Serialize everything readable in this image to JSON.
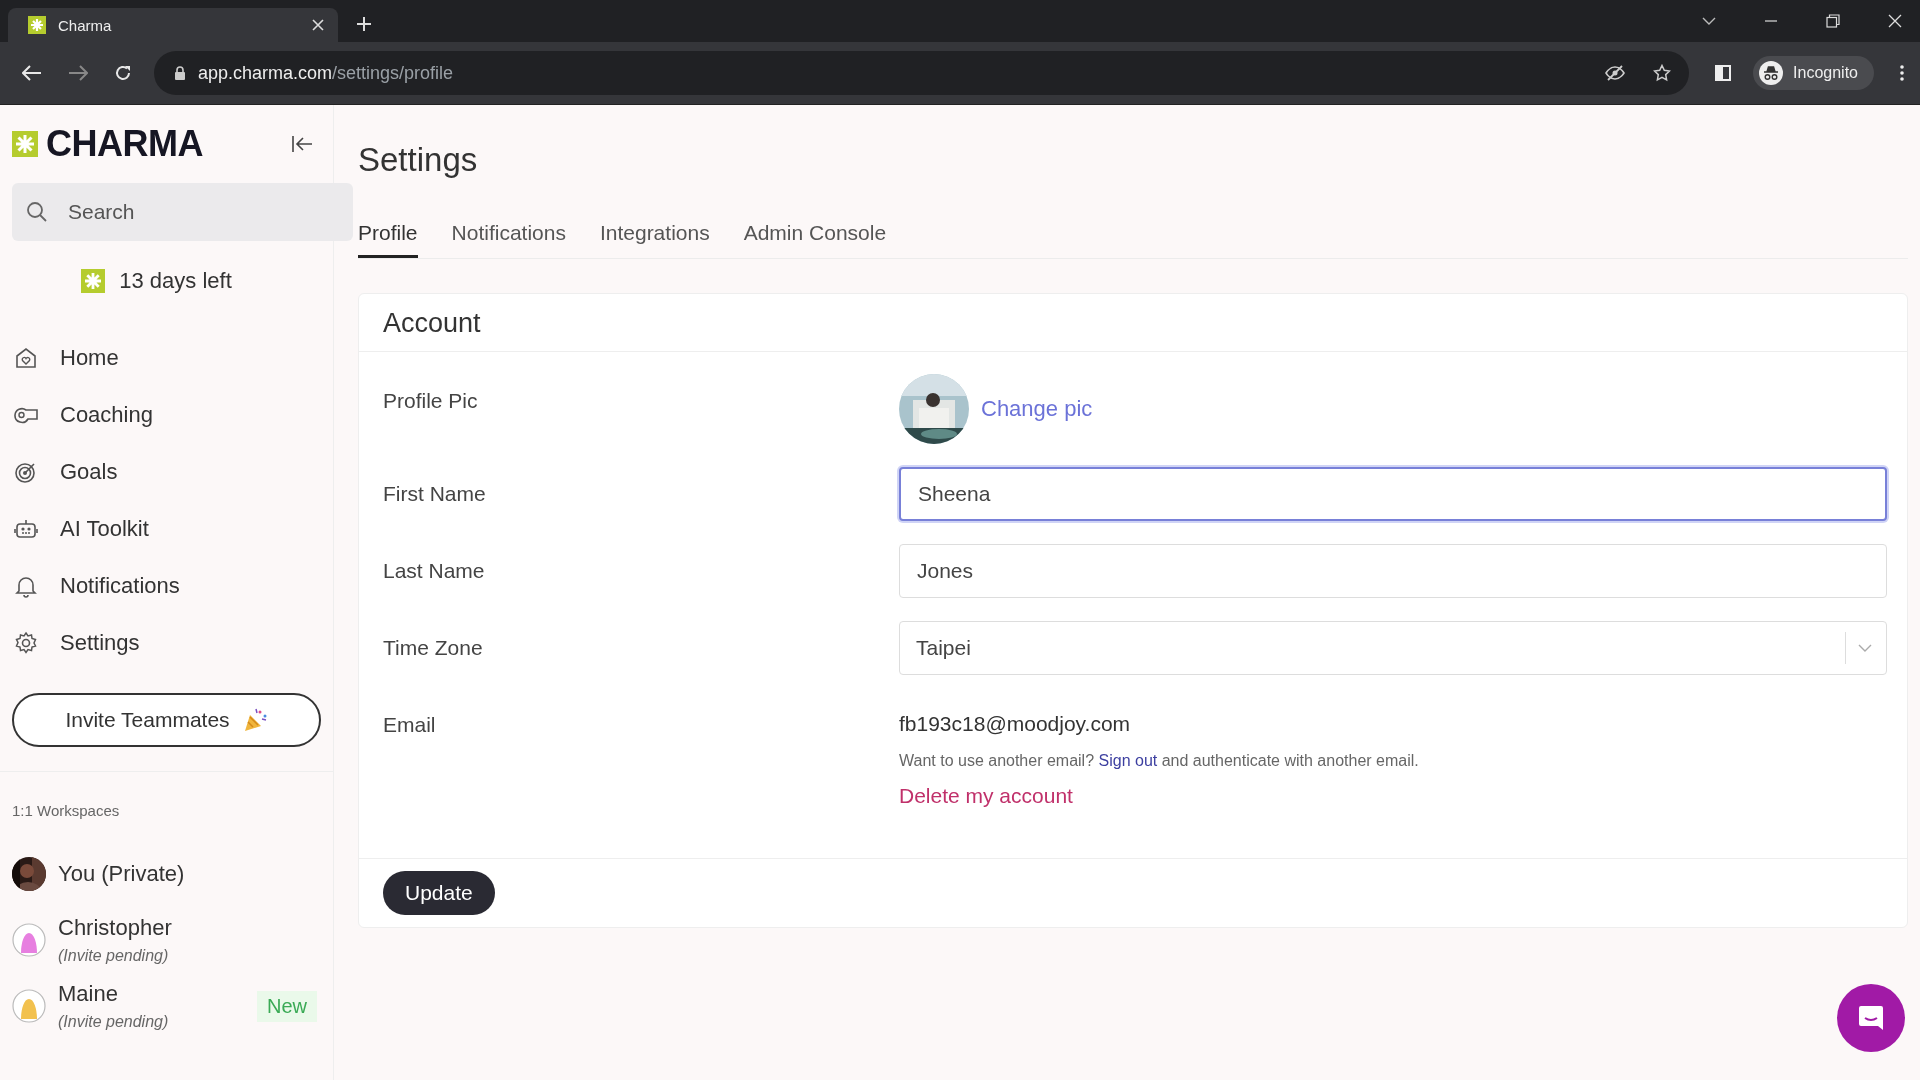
{
  "browser": {
    "tab": {
      "title": "Charma"
    },
    "address": {
      "host": "app.charma.com",
      "path": "/settings/profile"
    },
    "profile": "Incognito"
  },
  "sidebar": {
    "logo": "CHARMA",
    "search": {
      "placeholder": "Search"
    },
    "trial": "13 days left",
    "nav": [
      {
        "label": "Home",
        "selected": false
      },
      {
        "label": "Coaching",
        "selected": false
      },
      {
        "label": "Goals",
        "selected": false
      },
      {
        "label": "AI Toolkit",
        "selected": false
      },
      {
        "label": "Notifications",
        "selected": false
      },
      {
        "label": "Settings",
        "selected": false
      }
    ],
    "invite_button": "Invite Teammates",
    "workspaces_heading": "1:1 Workspaces",
    "workspaces": [
      {
        "name": "You (Private)"
      },
      {
        "name": "Christopher",
        "note": "(Invite pending)",
        "kind": "figure",
        "color": "#e77fe0"
      },
      {
        "name": "Maine",
        "note": "(Invite pending)",
        "kind": "figure",
        "color": "#f2c14e",
        "badge": "New"
      }
    ]
  },
  "main": {
    "title": "Settings",
    "tabs": [
      {
        "label": "Profile",
        "selected": true
      },
      {
        "label": "Notifications",
        "selected": false
      },
      {
        "label": "Integrations",
        "selected": false
      },
      {
        "label": "Admin Console",
        "selected": false
      }
    ],
    "card": {
      "heading": "Account",
      "rows": [
        {
          "kind": "picture",
          "label": "Profile Pic",
          "action": "Change pic"
        },
        {
          "kind": "text",
          "label": "First Name",
          "value": "Sheena",
          "focused": true
        },
        {
          "kind": "text",
          "label": "Last Name",
          "value": "Jones",
          "focused": false
        },
        {
          "kind": "select",
          "label": "Time Zone",
          "value": "Taipei"
        },
        {
          "kind": "email",
          "label": "Email",
          "value": "fb193c18@moodjoy.com",
          "hint_before": "Want to use another email?",
          "hint_link": "Sign out",
          "hint_after": "and authenticate with another email.",
          "delete": "Delete my account"
        }
      ],
      "submit": "Update"
    }
  }
}
